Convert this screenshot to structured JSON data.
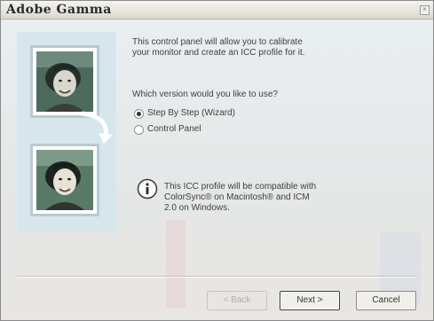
{
  "window": {
    "title": "Adobe Gamma",
    "close_glyph": "×"
  },
  "content": {
    "intro_line1": "This control panel will allow you to calibrate",
    "intro_line2": "your monitor and create an ICC profile for it.",
    "question": "Which version would you like to use?",
    "options": [
      {
        "label": "Step By Step (Wizard)",
        "selected": true
      },
      {
        "label": "Control Panel",
        "selected": false
      }
    ],
    "info_line1": "This ICC profile will be compatible with",
    "info_line2": "ColorSync® on Macintosh® and ICM",
    "info_line3": "2.0 on Windows."
  },
  "buttons": {
    "back_label": "< Back",
    "next_label": "Next >",
    "cancel_label": "Cancel"
  },
  "icons": {
    "info": "info-icon",
    "arrow": "curved-arrow-icon",
    "close": "close-icon"
  },
  "colors": {
    "panel_bg": "#d6e6ec",
    "window_bg": "#ece9e0"
  }
}
